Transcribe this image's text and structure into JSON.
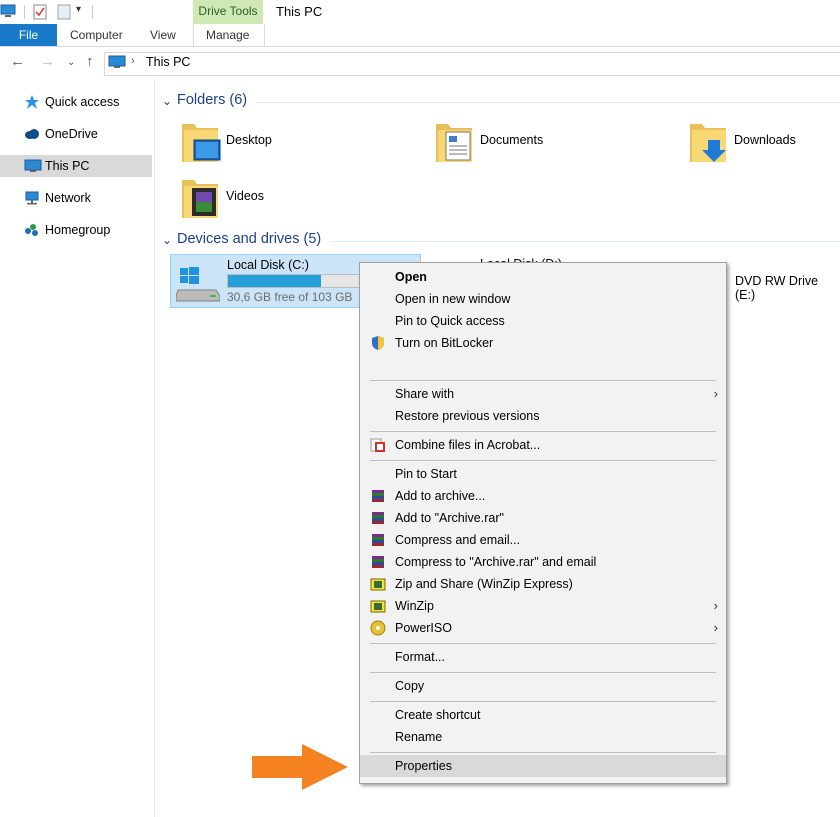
{
  "window": {
    "title": "This PC",
    "context_tab_header": "Drive Tools"
  },
  "ribbon": {
    "tabs": [
      "File",
      "Computer",
      "View",
      "Manage"
    ]
  },
  "address": {
    "path_text": "This PC"
  },
  "nav": {
    "items": [
      {
        "label": "Quick access",
        "icon": "quick-access-star-icon"
      },
      {
        "label": "OneDrive",
        "icon": "onedrive-cloud-icon"
      },
      {
        "label": "This PC",
        "icon": "this-pc-icon",
        "selected": true
      },
      {
        "label": "Network",
        "icon": "network-icon"
      },
      {
        "label": "Homegroup",
        "icon": "homegroup-icon"
      }
    ]
  },
  "content": {
    "folders_header": "Folders (6)",
    "folders": [
      {
        "label": "Desktop"
      },
      {
        "label": "Documents"
      },
      {
        "label": "Downloads"
      },
      {
        "label": "Videos"
      }
    ],
    "devices_header": "Devices and drives (5)",
    "drive_c": {
      "label": "Local Disk (C:)",
      "free_text": "30,6 GB free of 103 GB",
      "used_fraction": 0.7
    },
    "drive_d": {
      "label": "Local Disk (D:)"
    },
    "dvd": {
      "label": "DVD RW Drive (E:)"
    }
  },
  "menu": {
    "items": [
      {
        "label": "Open",
        "bold": true
      },
      {
        "label": "Open in new window"
      },
      {
        "label": "Pin to Quick access"
      },
      {
        "label": "Turn on BitLocker",
        "icon": "shield-icon"
      },
      {
        "label": "Share with",
        "submenu": true
      },
      {
        "label": "Restore previous versions"
      },
      {
        "label": "Combine files in Acrobat...",
        "icon": "acrobat-icon"
      },
      {
        "label": "Pin to Start"
      },
      {
        "label": "Add to archive...",
        "icon": "winrar-icon"
      },
      {
        "label": "Add to \"Archive.rar\"",
        "icon": "winrar-icon"
      },
      {
        "label": "Compress and email...",
        "icon": "winrar-icon"
      },
      {
        "label": "Compress to \"Archive.rar\" and email",
        "icon": "winrar-icon"
      },
      {
        "label": "Zip and Share (WinZip Express)",
        "icon": "winzip-icon"
      },
      {
        "label": "WinZip",
        "icon": "winzip-icon",
        "submenu": true
      },
      {
        "label": "PowerISO",
        "icon": "poweriso-icon",
        "submenu": true
      },
      {
        "label": "Format..."
      },
      {
        "label": "Copy"
      },
      {
        "label": "Create shortcut"
      },
      {
        "label": "Rename"
      },
      {
        "label": "Properties",
        "highlighted": true
      }
    ]
  },
  "colors": {
    "accent": "#1979ca",
    "arrow": "#f58220",
    "context_tab": "#cfe9b4",
    "selection": "#cce4f7"
  }
}
